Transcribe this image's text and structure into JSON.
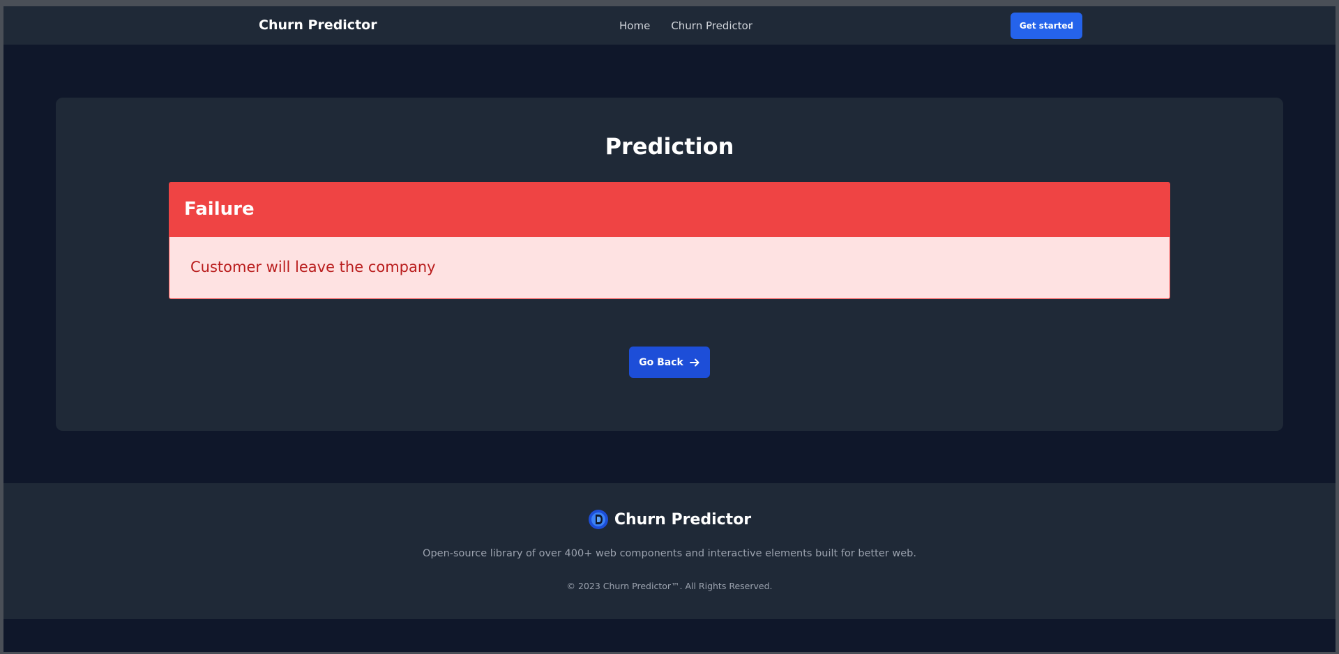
{
  "navbar": {
    "brand": "Churn Predictor",
    "links": [
      "Home",
      "Churn Predictor"
    ],
    "cta_label": "Get started"
  },
  "card": {
    "title": "Prediction",
    "alert": {
      "title": "Failure",
      "message": "Customer will leave the company"
    },
    "back_label": "Go Back"
  },
  "footer": {
    "brand": "Churn Predictor",
    "description": "Open-source library of over 400+ web components and interactive elements built for better web.",
    "copyright": "© 2023 Churn Predictor™. All Rights Reserved."
  },
  "icons": {
    "back_button": "arrow-right-icon",
    "footer_logo": "logo-icon"
  },
  "colors": {
    "background": "#0f172a",
    "surface": "#1f2937",
    "primary": "#2563eb",
    "danger": "#ef4444",
    "danger_light": "#fee2e2",
    "danger_text": "#b91c1c"
  }
}
